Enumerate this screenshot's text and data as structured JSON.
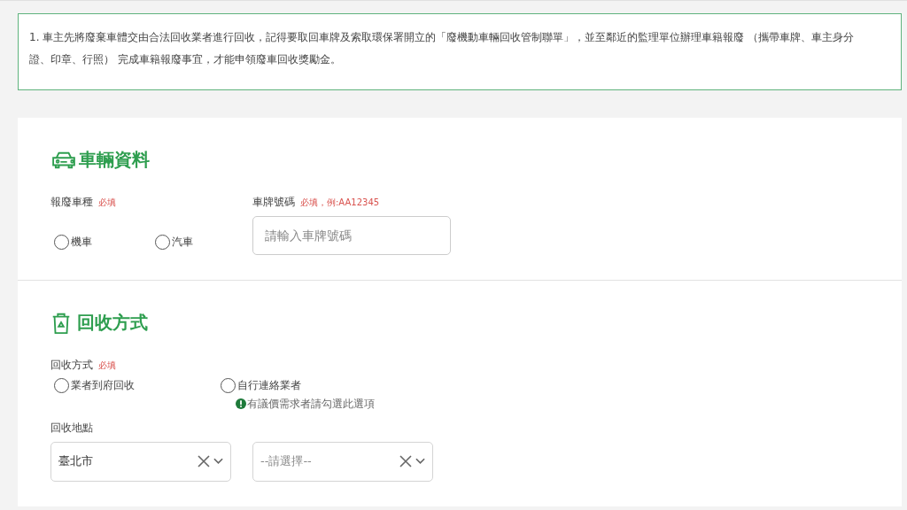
{
  "notice": {
    "text": "1. 車主先將廢棄車體交由合法回收業者進行回收，記得要取回車牌及索取環保署開立的「廢機動車輛回收管制聯單」，並至鄰近的監理單位辦理車籍報廢 （攜帶車牌、車主身分證、印章、行照） 完成車籍報廢事宜，才能申領廢車回收獎勵金。"
  },
  "vehicle_section": {
    "title": "車輛資料",
    "type_field": {
      "label": "報廢車種",
      "required": "必填",
      "options": [
        {
          "label": "機車",
          "selected": false
        },
        {
          "label": "汽車",
          "selected": false
        }
      ]
    },
    "plate_field": {
      "label": "車牌號碼",
      "required": "必填，例:AA12345",
      "placeholder": "請輸入車牌號碼"
    }
  },
  "recycle_section": {
    "title": "回收方式",
    "method_field": {
      "label": "回收方式",
      "required": "必填",
      "options": [
        {
          "label": "業者到府回收",
          "selected": false
        },
        {
          "label": "自行連絡業者",
          "selected": false,
          "hint": "有議價需求者請勾選此選項"
        }
      ]
    },
    "location_field": {
      "label": "回收地點",
      "selects": [
        {
          "value": "臺北市",
          "kind": "value"
        },
        {
          "value": "--請選擇--",
          "kind": "placeholder"
        }
      ]
    }
  }
}
